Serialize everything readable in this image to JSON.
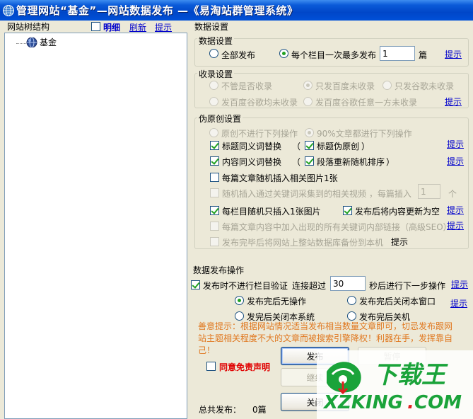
{
  "window": {
    "title": "管理网站“基金”—网站数据发布 —《易淘站群管理系统》",
    "icon": "globe-app-icon"
  },
  "tree": {
    "header": "网站树结构",
    "detail_label": "明细",
    "detail_checked": false,
    "refresh_link": "刷新",
    "tip_link": "提示",
    "node_label": "基金",
    "node_icon": "globe-icon"
  },
  "settings": {
    "header": "数据设置",
    "data_group": {
      "title": "数据设置",
      "all_publish": "全部发布",
      "per_column_max": "每个栏目一次最多发布",
      "per_column_value": "1",
      "unit": "篇",
      "tip": "提示",
      "selected": "per_column"
    },
    "index_group": {
      "title": "收录设置",
      "opt1": "不管是否收录",
      "opt2": "只发百度未收录",
      "opt3": "只发谷歌未收录",
      "opt4": "发百度谷歌均未收录",
      "opt5": "发百度谷歌任意一方未收录",
      "tip": "提示"
    },
    "pseudo_group": {
      "title": "伪原创设置",
      "radio1": "原创不进行下列操作",
      "radio2": "90%文章都进行下列操作",
      "title_synonym": "标题同义词替换",
      "title_pseudo": "标题伪原创",
      "paren_open": "（",
      "paren_close": "）",
      "content_synonym": "内容同义词替换",
      "para_shuffle": "段落重新随机排序",
      "insert_image": "每篇文章随机插入相关图片1张",
      "insert_video": "随机插入通过关键词采集到的相关视频 ，每篇插入",
      "video_count": "1",
      "video_unit": "个",
      "one_image": "每栏目随机只插入1张图片",
      "update_after": "发布后将内容更新为空",
      "internal_links": "每篇文章内容中加入出现的所有关键词内部链接（高级SEO）",
      "backup_db": "发布完毕后将网站上整站数据库备份到本机",
      "tip": "提示"
    }
  },
  "publish": {
    "title": "数据发布操作",
    "no_verify": "发布时不进行栏目验证",
    "connect_over": "连接超过",
    "seconds_value": "30",
    "seconds_after": "秒后进行下一步操作",
    "tip": "提示",
    "after_none": "发布完后无操作",
    "after_close_window": "发布完后关闭本窗口",
    "after_close_system": "发完后关闭本系统",
    "after_shutdown": "发布完后关机",
    "notice": "善意提示：根据网站情况适当发布相当数量文章即可，切忌发布跟网站主题相关程度不大的文章而被搜索引擎降权！利器在手，发挥靠自己！",
    "publish_btn": "发布",
    "pause_btn": "暂停",
    "continue_btn": "继续",
    "close_btn": "关闭",
    "agree_label": "同意免责声明",
    "total_label": "总共发布：",
    "total_value": "0篇"
  },
  "watermark": {
    "brand": "下载王",
    "url": "XZKING.COM",
    "colors": {
      "green": "#1aa33a",
      "red": "#e02020",
      "orange": "#f08a00"
    }
  }
}
